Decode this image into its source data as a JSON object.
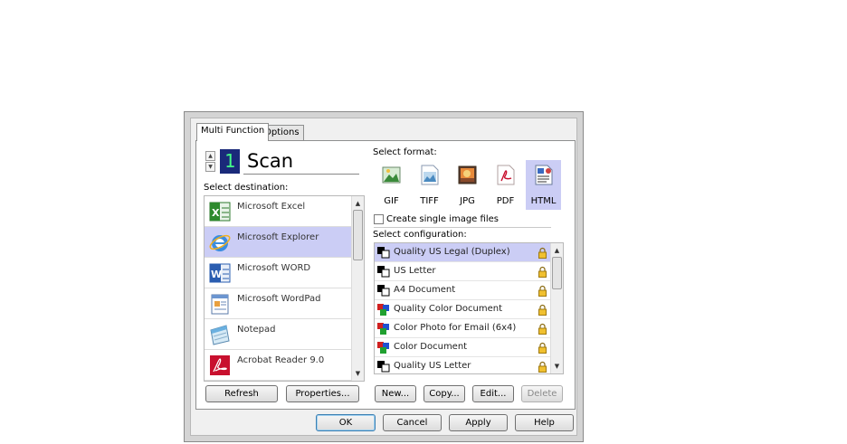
{
  "tabs": [
    {
      "label": "Multi Function"
    },
    {
      "label": "Options"
    }
  ],
  "scan": {
    "title": "Scan",
    "icon_text": "1"
  },
  "destination": {
    "label": "Select destination:",
    "items": [
      {
        "label": "Microsoft Excel",
        "icon": "excel-icon"
      },
      {
        "label": "Microsoft Explorer",
        "icon": "ie-icon"
      },
      {
        "label": "Microsoft WORD",
        "icon": "word-icon"
      },
      {
        "label": "Microsoft WordPad",
        "icon": "wordpad-icon"
      },
      {
        "label": "Notepad",
        "icon": "notepad-icon"
      },
      {
        "label": "Acrobat Reader 9.0",
        "icon": "acrobat-icon"
      }
    ],
    "selected": "Microsoft Explorer",
    "refresh_label": "Refresh",
    "properties_label": "Properties..."
  },
  "format": {
    "label": "Select format:",
    "items": [
      {
        "label": "GIF"
      },
      {
        "label": "TIFF"
      },
      {
        "label": "JPG"
      },
      {
        "label": "PDF"
      },
      {
        "label": "HTML"
      }
    ],
    "selected": "HTML"
  },
  "single_image": {
    "label": "Create single image files",
    "checked": false
  },
  "configuration": {
    "label": "Select configuration:",
    "items": [
      {
        "label": "Quality US Legal (Duplex)",
        "icon": "bw-icon"
      },
      {
        "label": "US Letter",
        "icon": "bw-icon"
      },
      {
        "label": "A4 Document",
        "icon": "bw-icon"
      },
      {
        "label": "Quality Color Document",
        "icon": "color-icon"
      },
      {
        "label": "Color Photo for Email (6x4)",
        "icon": "color-icon"
      },
      {
        "label": "Color Document",
        "icon": "color-icon"
      },
      {
        "label": "Quality US Letter",
        "icon": "bw-icon"
      }
    ],
    "selected": "Quality US Legal (Duplex)",
    "new_label": "New...",
    "copy_label": "Copy...",
    "edit_label": "Edit...",
    "delete_label": "Delete"
  },
  "footer": {
    "ok_label": "OK",
    "cancel_label": "Cancel",
    "apply_label": "Apply",
    "help_label": "Help"
  },
  "colors": {
    "selection": "#cbcdf5",
    "scan_icon_bg": "#1a2a7a",
    "scan_icon_digit": "#44ff88"
  }
}
